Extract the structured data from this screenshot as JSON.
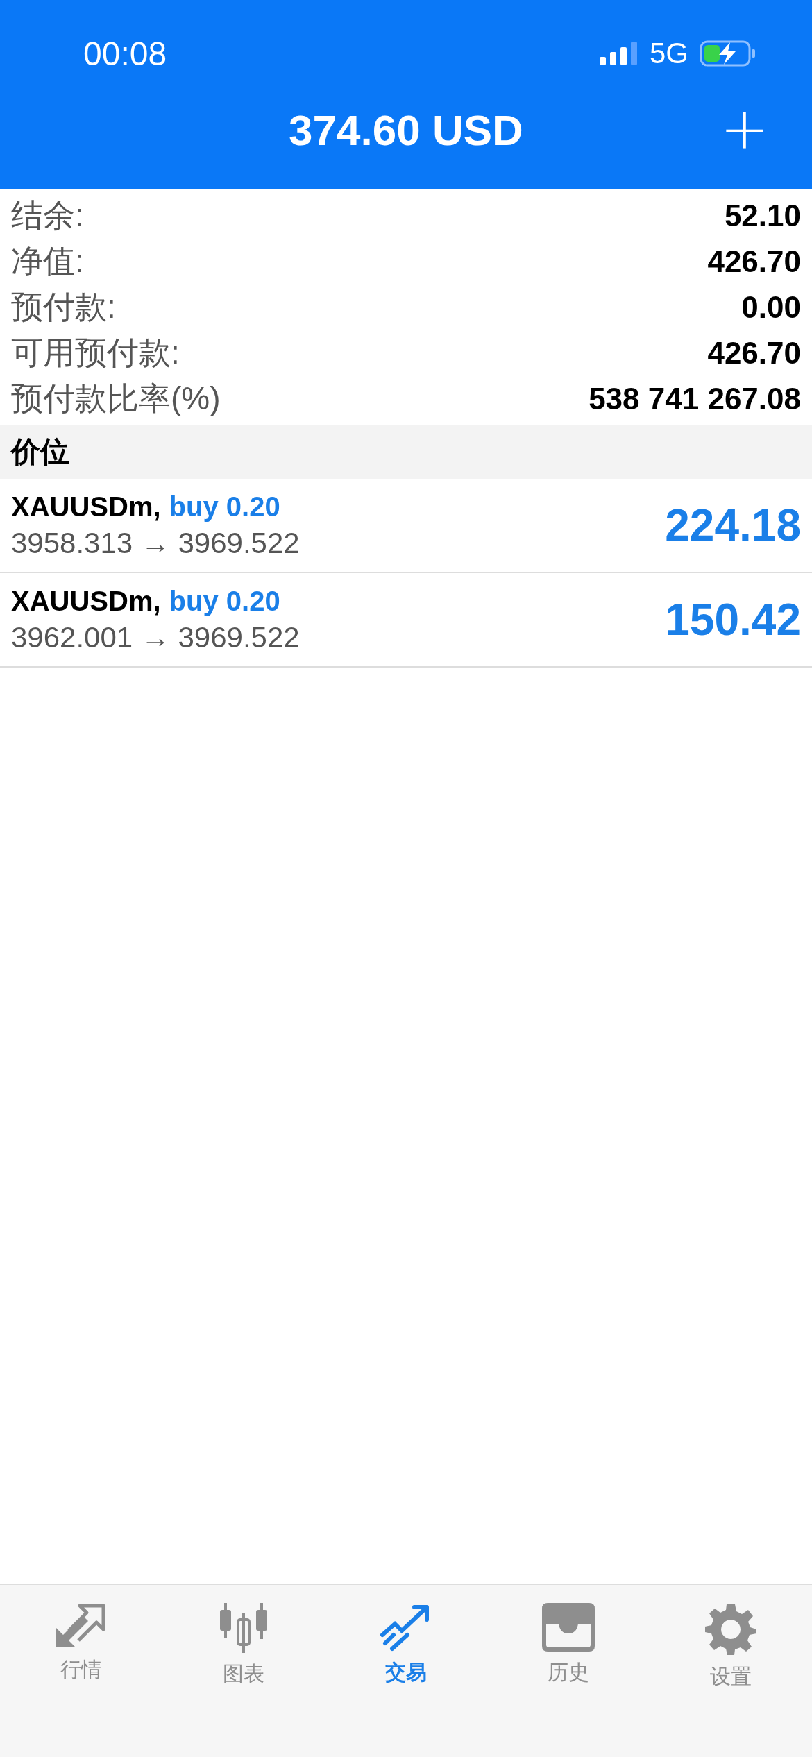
{
  "status_bar": {
    "time": "00:08",
    "network": "5G"
  },
  "header": {
    "title": "374.60 USD",
    "add_button": "+"
  },
  "summary": [
    {
      "label": "结余:",
      "value": "52.10"
    },
    {
      "label": "净值:",
      "value": "426.70"
    },
    {
      "label": "预付款:",
      "value": "0.00"
    },
    {
      "label": "可用预付款:",
      "value": "426.70"
    },
    {
      "label": "预付款比率(%)",
      "value": "538 741 267.08"
    }
  ],
  "positions_header": "价位",
  "positions": [
    {
      "symbol": "XAUUSDm,",
      "order": "buy 0.20",
      "prices": "3958.313 → 3969.522",
      "profit": "224.18"
    },
    {
      "symbol": "XAUUSDm,",
      "order": "buy 0.20",
      "prices": "3962.001 → 3969.522",
      "profit": "150.42"
    }
  ],
  "tabs": [
    {
      "kind": "quotes",
      "label": "行情",
      "selected": false
    },
    {
      "kind": "chart",
      "label": "图表",
      "selected": false
    },
    {
      "kind": "trade",
      "label": "交易",
      "selected": true
    },
    {
      "kind": "history",
      "label": "历史",
      "selected": false
    },
    {
      "kind": "settings",
      "label": "设置",
      "selected": false
    }
  ]
}
